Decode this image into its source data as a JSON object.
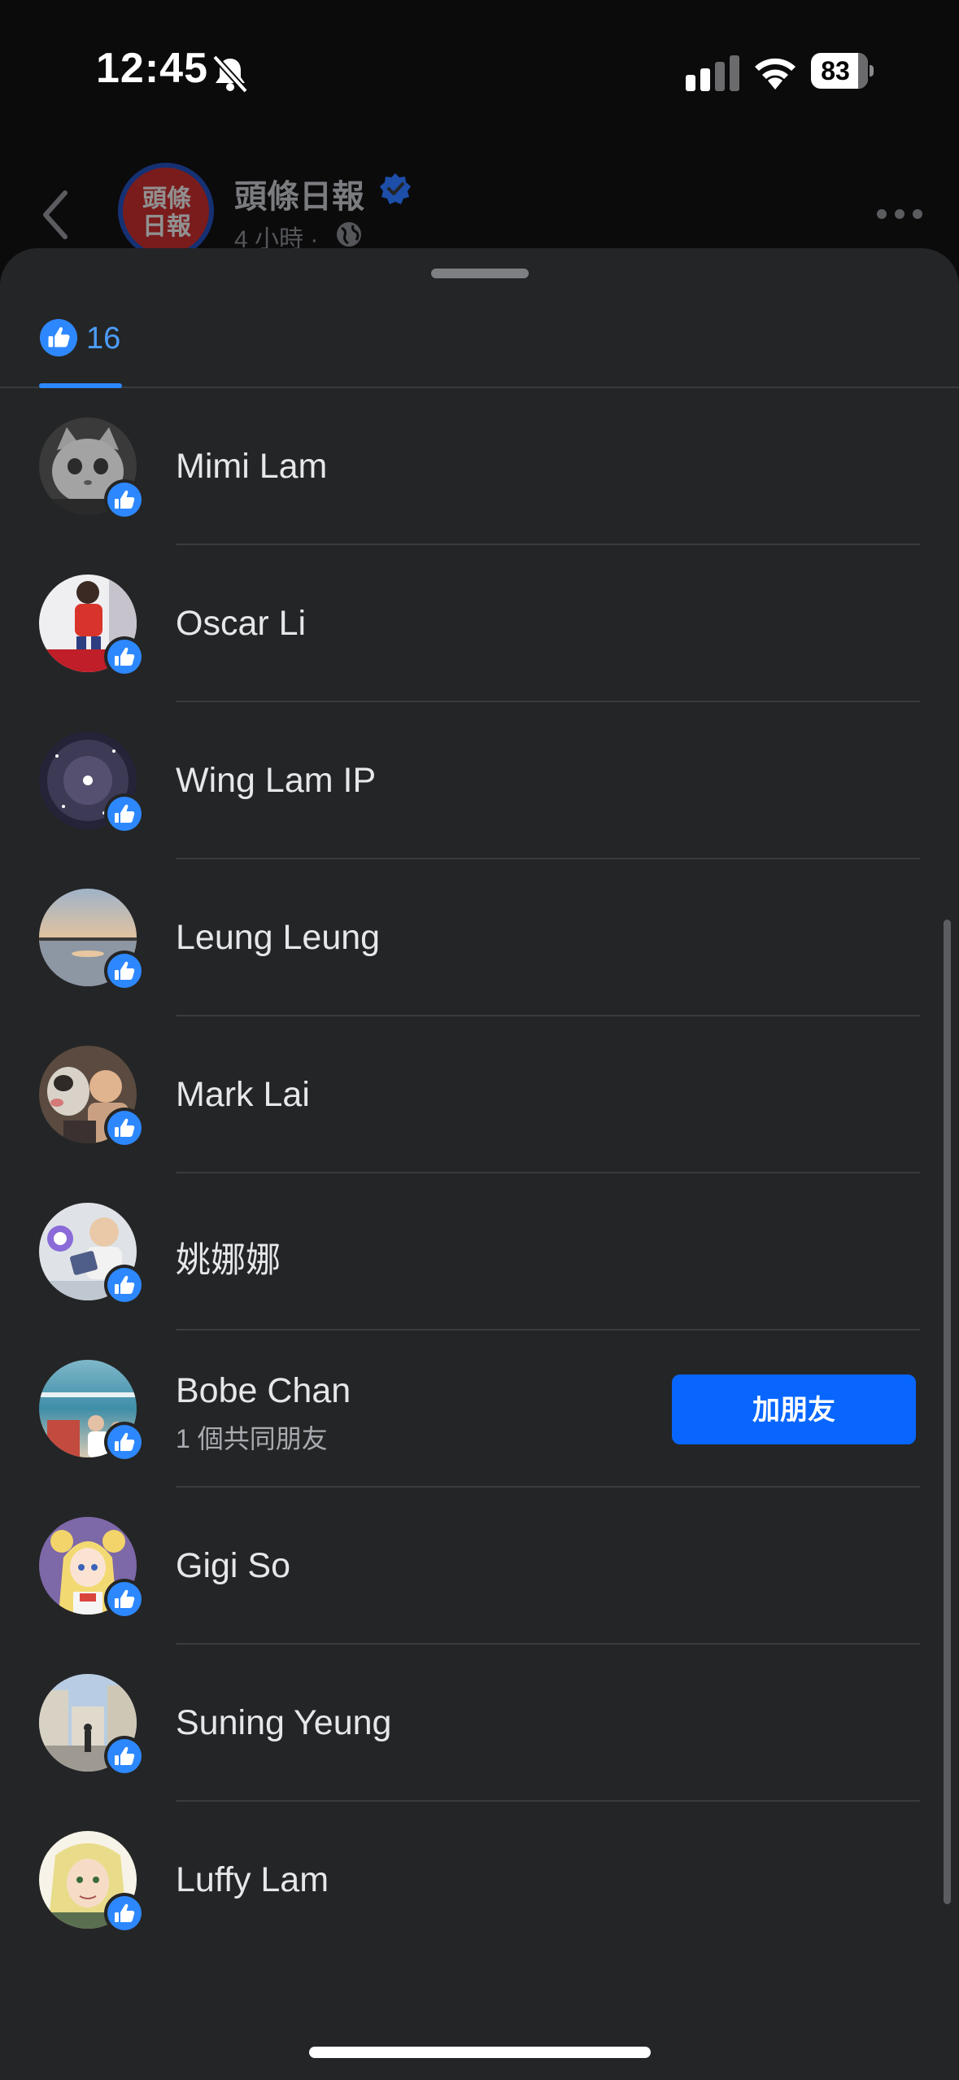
{
  "status_bar": {
    "time": "12:45",
    "battery": "83",
    "battery_level_percent": 83
  },
  "post_header": {
    "page_name": "頭條日報",
    "page_avatar_text": "頭條日報",
    "meta": "4 小時 ·"
  },
  "reactions": {
    "tab_count": "16"
  },
  "people": [
    {
      "name": "",
      "avatar": "partial-avatar"
    },
    {
      "name": "Mimi Lam",
      "avatar": "grey-cat"
    },
    {
      "name": "Oscar Li",
      "avatar": "child-red-shirt"
    },
    {
      "name": "Wing Lam IP",
      "avatar": "night-sky"
    },
    {
      "name": "Leung Leung",
      "avatar": "sunset-lake"
    },
    {
      "name": "Mark Lai",
      "avatar": "man-with-dog"
    },
    {
      "name": "姚娜娜",
      "avatar": "baby-with-sticker"
    },
    {
      "name": "Bobe Chan",
      "avatar": "beach-photo",
      "mutual": "1 個共同朋友",
      "button": "加朋友"
    },
    {
      "name": "Gigi So",
      "avatar": "anime-girl"
    },
    {
      "name": "Suning Yeung",
      "avatar": "street-scene"
    },
    {
      "name": "Luffy Lam",
      "avatar": "anime-blonde"
    }
  ],
  "colors": {
    "sheet_bg": "#242526",
    "accent_blue": "#0866ff",
    "like_blue": "#2d88ff",
    "text_primary": "#e6e7eb",
    "text_secondary": "#a8abb0"
  }
}
